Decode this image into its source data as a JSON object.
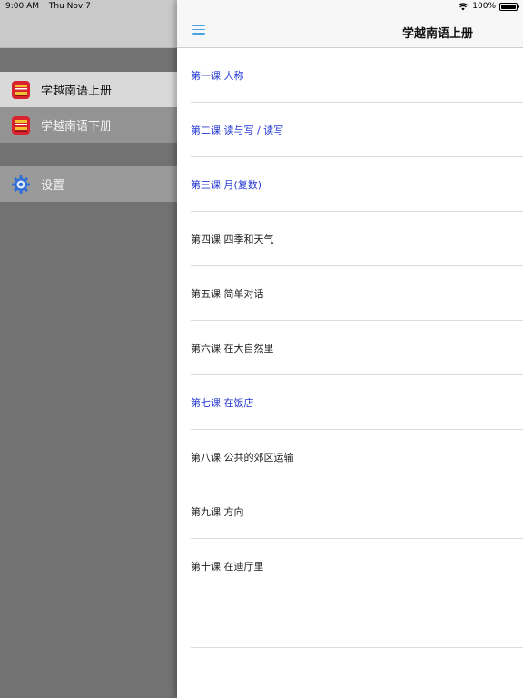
{
  "status": {
    "time": "9:00 AM",
    "date": "Thu Nov 7",
    "battery": "100%"
  },
  "sidebar": {
    "items": [
      {
        "label": "学越南语上册",
        "icon": "book-icon",
        "state": "active"
      },
      {
        "label": "学越南语下册",
        "icon": "book-icon",
        "state": "normal"
      }
    ],
    "settings_label": "设置",
    "settings_icon": "gear-icon"
  },
  "nav": {
    "menu_icon": "hamburger-menu-icon",
    "title": "学越南语上册"
  },
  "lessons": [
    {
      "label": "第一课 人称",
      "color": "#2438d4"
    },
    {
      "label": "第二课 读与写 / 读写",
      "color": "#2438d4"
    },
    {
      "label": "第三课 月(复数)",
      "color": "#2438d4"
    },
    {
      "label": "第四课 四季和天气",
      "color": "#222222"
    },
    {
      "label": "第五课 简单对话",
      "color": "#222222"
    },
    {
      "label": "第六课 在大自然里",
      "color": "#222222"
    },
    {
      "label": "第七课 在饭店",
      "color": "#2438d4"
    },
    {
      "label": "第八课 公共的郊区运输",
      "color": "#222222"
    },
    {
      "label": "第九课 方向",
      "color": "#222222"
    },
    {
      "label": "第十课 在迪厅里",
      "color": "#222222"
    }
  ],
  "colors": {
    "accent": "#4aa3df",
    "link": "#2438d4",
    "sidebar_bg": "#727272",
    "book_red": "#d9232e",
    "book_yellow": "#f2c230"
  }
}
